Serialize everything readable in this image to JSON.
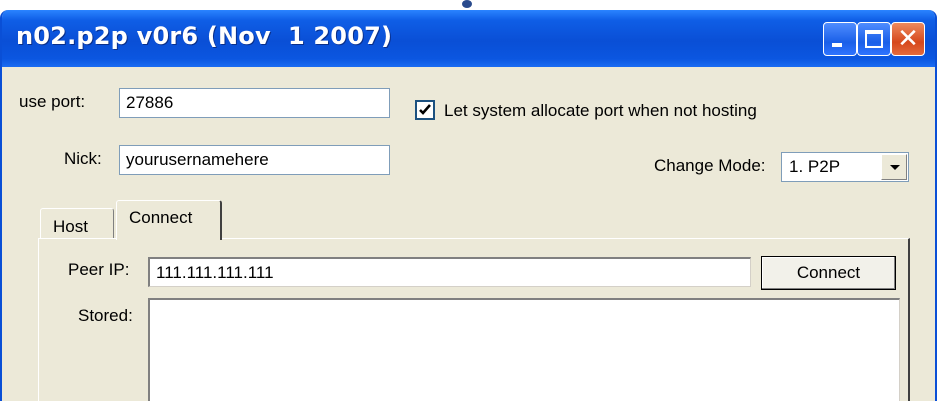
{
  "window": {
    "title": "n02.p2p v0r6 (Nov  1 2007)"
  },
  "controls": {
    "port_label": "use port:",
    "port_value": "27886",
    "allocate_label": "Let system allocate port when not hosting",
    "allocate_checked": true,
    "nick_label": "Nick:",
    "nick_value": "yourusernamehere",
    "mode_label": "Change Mode:",
    "mode_value": "1. P2P"
  },
  "tabs": [
    {
      "label": "Host",
      "active": false
    },
    {
      "label": "Connect",
      "active": true
    }
  ],
  "connect_tab": {
    "peer_ip_label": "Peer IP:",
    "peer_ip_value": "111.111.111.111",
    "connect_button": "Connect",
    "stored_label": "Stored:"
  },
  "icons": {
    "minimize": "minimize-icon",
    "maximize": "maximize-icon",
    "close": "close-icon",
    "check": "check-icon",
    "dropdown": "chevron-down-icon"
  }
}
